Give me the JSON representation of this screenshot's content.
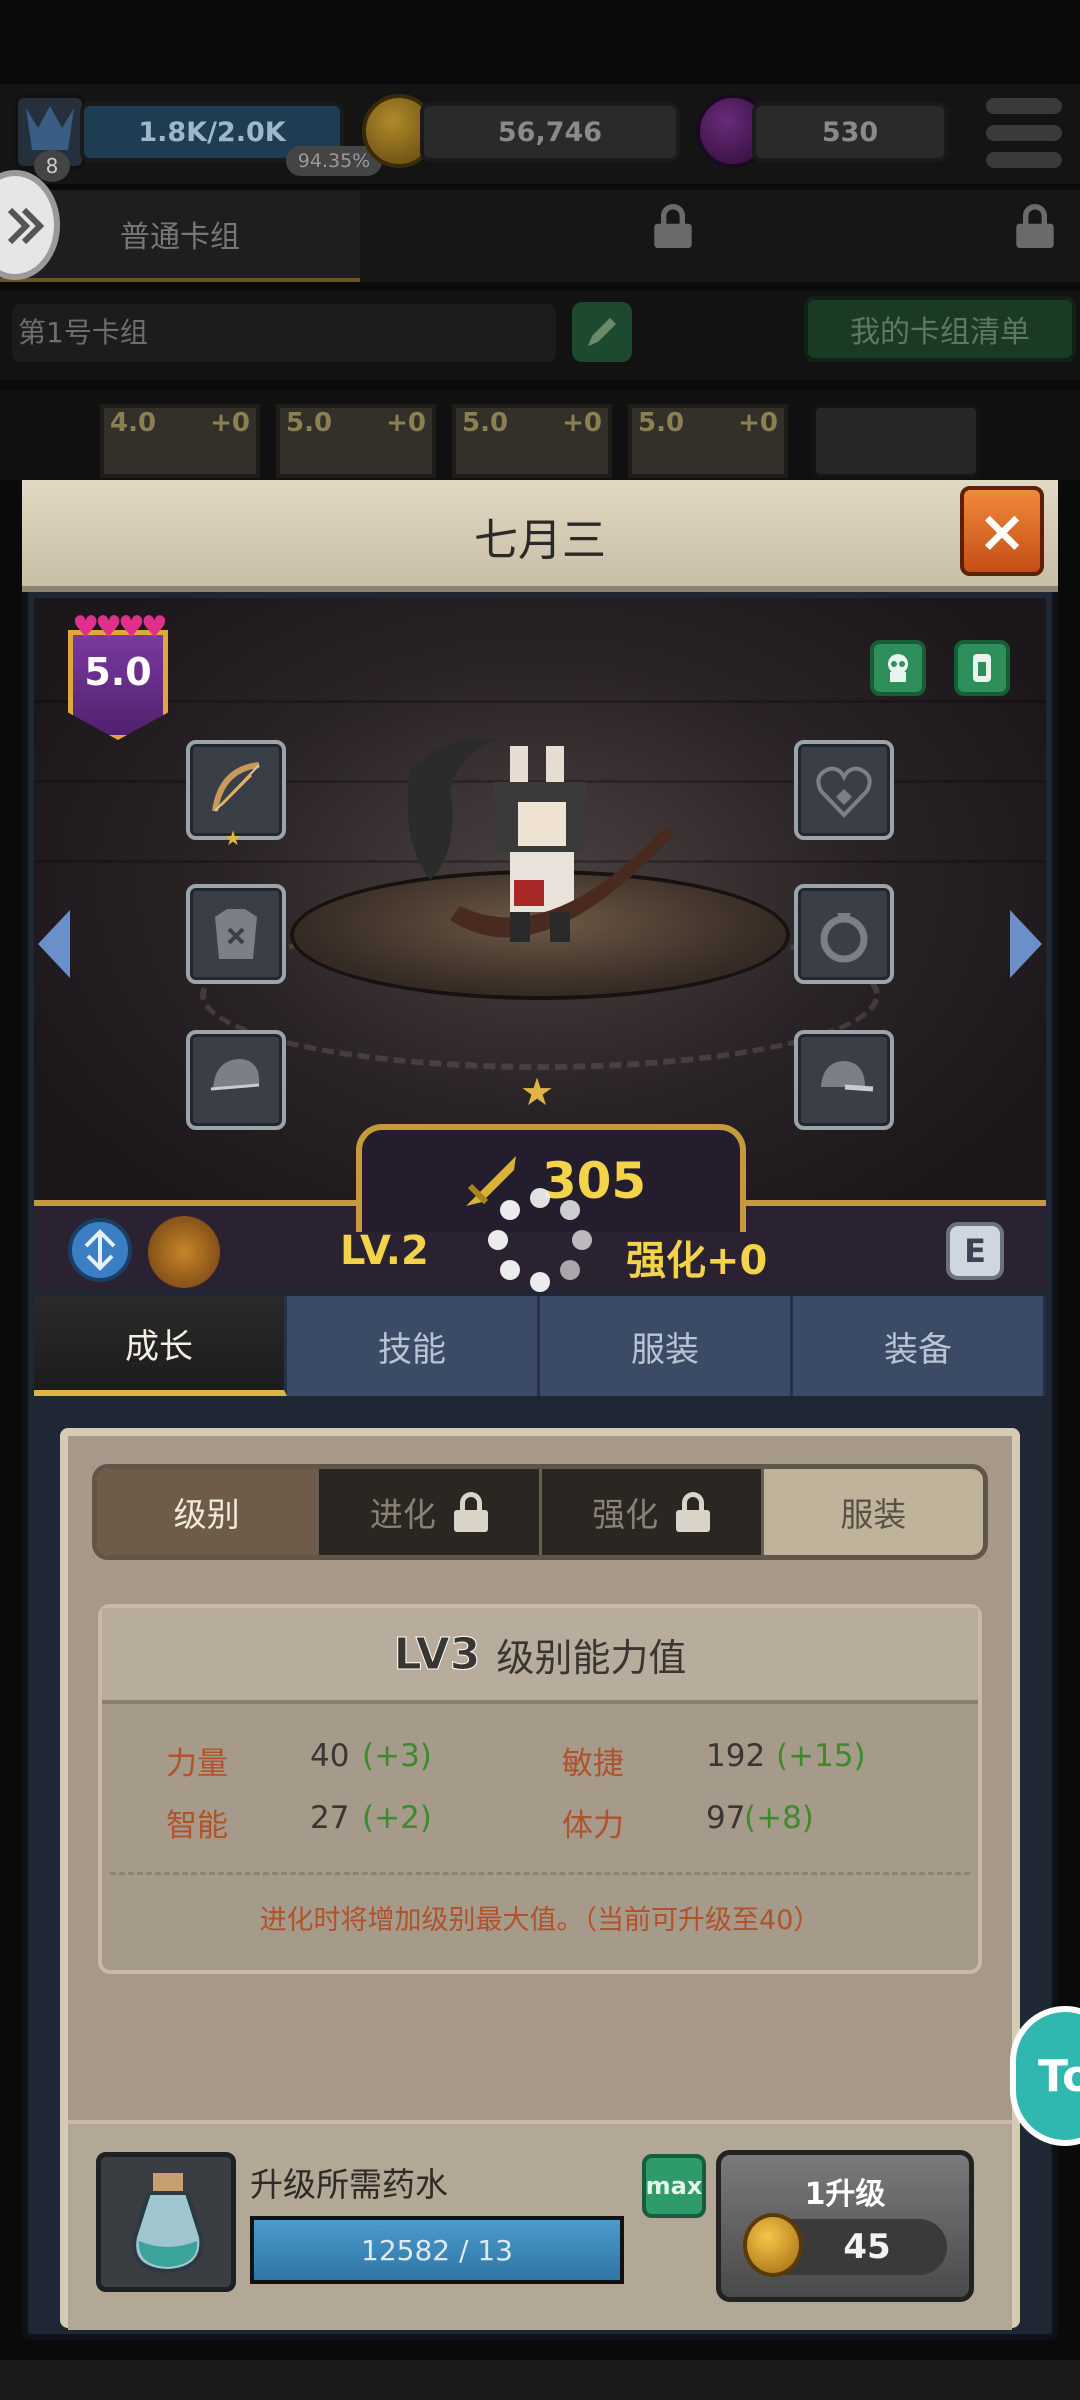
{
  "topbar": {
    "exp_text": "1.8K/2.0K",
    "exp_percent": "94.35%",
    "exp_level": "8",
    "gold": "56,746",
    "gems": "530"
  },
  "deck_tabs": {
    "normal": "普通卡组"
  },
  "deck": {
    "name": "第1号卡组",
    "list_button": "我的卡组清单"
  },
  "mini_cards": [
    {
      "grade": "4.0",
      "plus": "+0"
    },
    {
      "grade": "5.0",
      "plus": "+0"
    },
    {
      "grade": "5.0",
      "plus": "+0"
    },
    {
      "grade": "5.0",
      "plus": "+0"
    }
  ],
  "modal": {
    "title": "七月三",
    "close_label": "×",
    "grade": "5.0",
    "hearts": "♥♥♥♥",
    "power": "305",
    "level": "LV.2",
    "enhance": "强化+0",
    "e_label": "E"
  },
  "main_tabs": [
    {
      "label": "成长",
      "active": true
    },
    {
      "label": "技能",
      "active": false
    },
    {
      "label": "服装",
      "active": false
    },
    {
      "label": "装备",
      "active": false
    }
  ],
  "sub_tabs": [
    {
      "label": "级别",
      "state": "active"
    },
    {
      "label": "进化",
      "state": "locked"
    },
    {
      "label": "强化",
      "state": "locked"
    },
    {
      "label": "服装",
      "state": "normal"
    }
  ],
  "stats": {
    "lv_mark": "LV3",
    "title": "级别能力值",
    "rows": [
      {
        "label": "力量",
        "value": "40",
        "bonus": "(+3)"
      },
      {
        "label": "敏捷",
        "value": "192",
        "bonus": "(+15)"
      },
      {
        "label": "智能",
        "value": "27",
        "bonus": "(+2)"
      },
      {
        "label": "体力",
        "value": "97",
        "bonus": "(+8)"
      }
    ],
    "note": "进化时将增加级别最大值。（当前可升级至40）"
  },
  "upgrade": {
    "need_label": "升级所需药水",
    "potion_progress": "12582 / 13",
    "potion_fill_fraction": 1.0,
    "max_label": "max",
    "button_label": "1升级",
    "cost": "45"
  },
  "side": {
    "right_label": "To"
  },
  "colors": {
    "accent_gold": "#f2d34a",
    "stat_label": "#b0522a",
    "bonus_green": "#3e8a2e"
  }
}
